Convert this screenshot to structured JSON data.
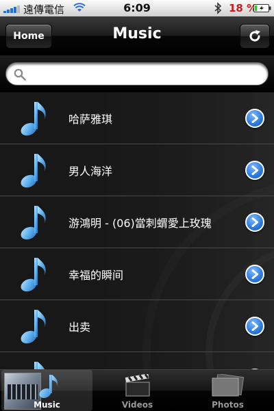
{
  "status_bar": {
    "carrier": "遠傳電信",
    "time": "6:09",
    "battery_percent": "18 %",
    "battery_level": 0.18,
    "signal_bars": 4,
    "icons": [
      "signal-icon",
      "wifi-icon",
      "bluetooth-icon",
      "battery-icon"
    ]
  },
  "nav": {
    "title": "Music",
    "home_label": "Home",
    "refresh_icon": "refresh-icon"
  },
  "search": {
    "placeholder": "",
    "value": "",
    "icon": "search-icon"
  },
  "list": {
    "item_icon": "music-note-icon",
    "accessory_icon": "chevron-right-icon",
    "items": [
      {
        "label": "哈萨雅琪"
      },
      {
        "label": "男人海洋"
      },
      {
        "label": "游鴻明 - (06)當刺蝟愛上玫瑰"
      },
      {
        "label": "幸福的瞬间"
      },
      {
        "label": "出卖"
      },
      {
        "label": ""
      }
    ]
  },
  "tab_bar": {
    "tabs": [
      {
        "label": "Music",
        "icon": "music-note-icon",
        "active": true
      },
      {
        "label": "Videos",
        "icon": "clapperboard-icon",
        "active": false
      },
      {
        "label": "Photos",
        "icon": "photos-icon",
        "active": false
      }
    ]
  },
  "colors": {
    "accent_blue": "#2f7fe0",
    "note_blue": "#4fa3e8",
    "battery_red": "#d01818",
    "battery_green": "#3fbf2f"
  }
}
